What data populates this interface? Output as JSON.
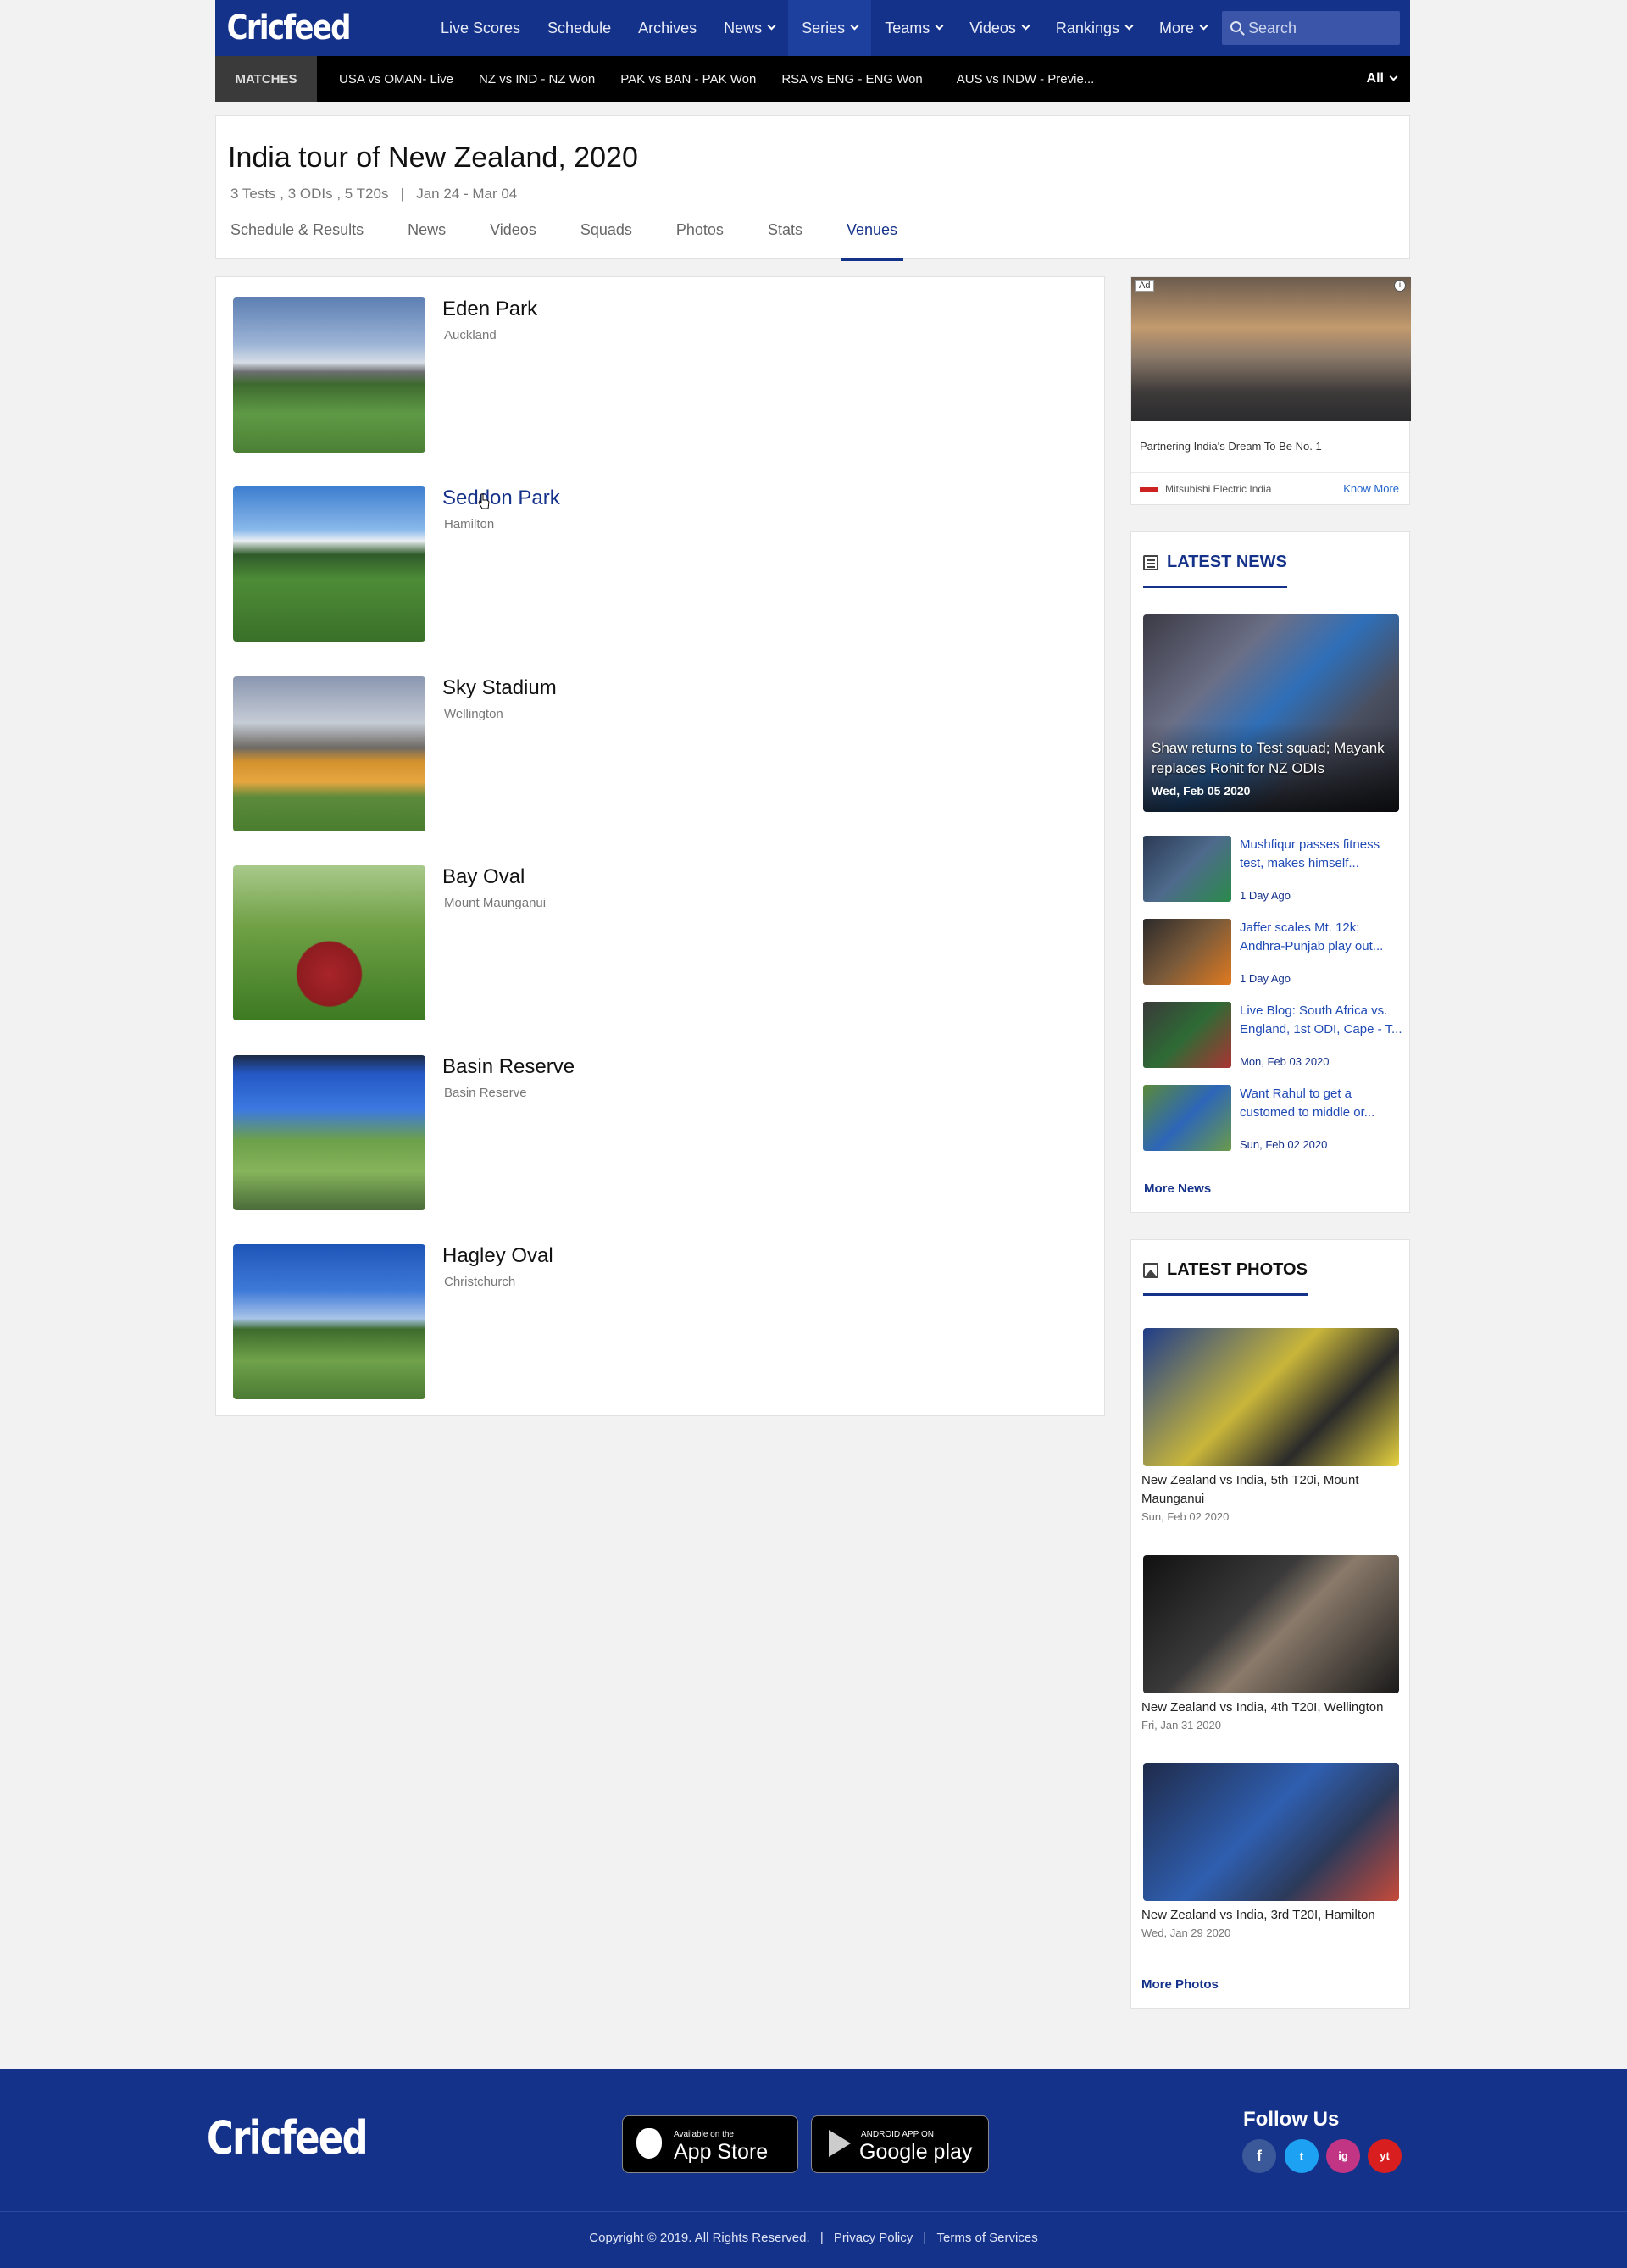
{
  "header": {
    "logo": "Cricfeed",
    "nav": [
      "Live Scores",
      "Schedule",
      "Archives",
      "News",
      "Series",
      "Teams",
      "Videos",
      "Rankings",
      "More"
    ],
    "search_placeholder": "Search"
  },
  "matchbar": {
    "label": "MATCHES",
    "matches": [
      "USA vs OMAN- Live",
      "NZ vs IND - NZ Won",
      "PAK vs BAN - PAK Won",
      "RSA vs  ENG - ENG Won",
      "AUS vs INDW - Previe..."
    ],
    "filter": "All"
  },
  "series": {
    "title": "India tour of New Zealand, 2020",
    "meta": "3 Tests , 3 ODIs , 5 T20s   |   Jan 24 - Mar 04",
    "tabs": [
      "Schedule & Results",
      "News",
      "Videos",
      "Squads",
      "Photos",
      "Stats",
      "Venues"
    ],
    "active_tab": "Venues"
  },
  "venues": [
    {
      "name": "Eden Park",
      "city": "Auckland"
    },
    {
      "name": "Seddon Park",
      "city": "Hamilton"
    },
    {
      "name": "Sky Stadium",
      "city": "Wellington"
    },
    {
      "name": "Bay Oval",
      "city": "Mount Maunganui"
    },
    {
      "name": "Basin Reserve",
      "city": "Basin Reserve"
    },
    {
      "name": "Hagley Oval",
      "city": "Christchurch"
    }
  ],
  "ad": {
    "badge": "Ad",
    "info": "i",
    "tagline": "Partnering India's Dream To Be No. 1",
    "brand": "Mitsubishi Electric India",
    "cta": "Know More"
  },
  "latest_news": {
    "heading": "LATEST NEWS",
    "feature": {
      "title": "Shaw returns to Test squad; Mayank replaces Rohit for NZ ODIs",
      "date": "Wed, Feb 05 2020"
    },
    "items": [
      {
        "title": "Mushfiqur passes fitness\ntest, makes himself...",
        "date": "1 Day Ago"
      },
      {
        "title": "Jaffer scales Mt. 12k;\nAndhra-Punjab play out...",
        "date": "1 Day Ago"
      },
      {
        "title": "Live Blog: South Africa vs.\nEngland, 1st ODI, Cape - T...",
        "date": "Mon, Feb 03 2020"
      },
      {
        "title": "Want Rahul to get a\ncustomed to middle or...",
        "date": "Sun, Feb 02 2020"
      }
    ],
    "more": "More News"
  },
  "latest_photos": {
    "heading": "LATEST PHOTOS",
    "items": [
      {
        "caption": "New Zealand vs India, 5th T20i, Mount Maunganui",
        "date": "Sun, Feb 02 2020"
      },
      {
        "caption": "New Zealand vs India, 4th T20I, Wellington",
        "date": "Fri, Jan 31 2020"
      },
      {
        "caption": "New Zealand vs India, 3rd T20I, Hamilton",
        "date": "Wed, Jan 29 2020"
      }
    ],
    "more": "More Photos"
  },
  "footer": {
    "logo": "Cricfeed",
    "appstore_small": "Available on the",
    "appstore_big": "App Store",
    "play_small": "ANDROID APP ON",
    "play_big": "Google play",
    "follow": "Follow Us",
    "social": [
      "f",
      "t",
      "ig",
      "yt"
    ],
    "copyright": "Copyright © 2019. All Rights Reserved.",
    "sep": "|",
    "privacy": "Privacy Policy",
    "terms": "Terms of Services"
  },
  "colors": {
    "brand": "#15328a",
    "link": "#1f4ab5",
    "matchbar": "#000000",
    "page_bg": "#f2f2f2"
  }
}
